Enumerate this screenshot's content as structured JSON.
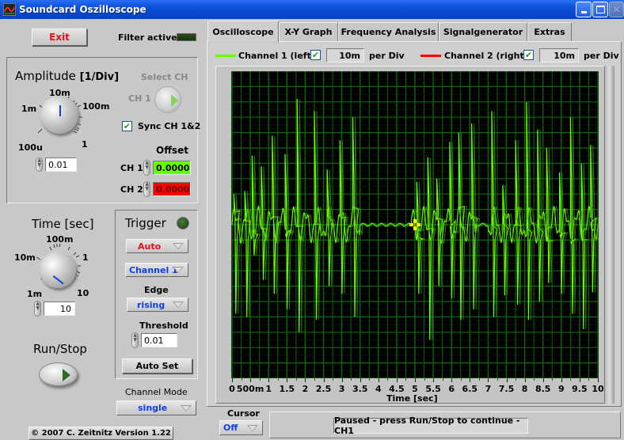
{
  "window": {
    "title": "Soundcard Oszilloscope",
    "controls": [
      "minimize",
      "maximize",
      "close"
    ]
  },
  "left_panel": {
    "exit_label": "Exit",
    "filter_label": "Filter active",
    "amplitude": {
      "title": "Amplitude",
      "unit": "[1/Div]",
      "knob_ticks": [
        "100u",
        "1m",
        "10m",
        "100m",
        "1"
      ],
      "value": "0.01"
    },
    "select_ch": {
      "label": "Select CH",
      "channel": "CH 1"
    },
    "sync": {
      "label": "Sync CH 1&2",
      "checked": true
    },
    "offset": {
      "title": "Offset",
      "ch1_label": "CH 1",
      "ch1_value": "0.0000",
      "ch2_label": "CH 2",
      "ch2_value": "0.0000"
    },
    "time": {
      "title": "Time [sec]",
      "knob_ticks": [
        "1m",
        "10m",
        "100m",
        "1",
        "10"
      ],
      "value": "10"
    },
    "trigger": {
      "title": "Trigger",
      "mode": "Auto",
      "source": "Channel 1",
      "edge_label": "Edge",
      "edge": "rising",
      "threshold_label": "Threshold",
      "threshold": "0.01",
      "autoset_label": "Auto Set"
    },
    "runstop_label": "Run/Stop",
    "channel_mode_label": "Channel Mode",
    "channel_mode": "single",
    "copyright": "© 2007   C. Zeitnitz Version 1.22"
  },
  "tabs": [
    {
      "label": "Oscilloscope",
      "active": true
    },
    {
      "label": "X-Y Graph",
      "active": false
    },
    {
      "label": "Frequency Analysis",
      "active": false
    },
    {
      "label": "Signalgenerator",
      "active": false
    },
    {
      "label": "Extras",
      "active": false
    }
  ],
  "channels": {
    "ch1": {
      "label": "Channel 1 (left)",
      "enabled": true,
      "per_div": "10m",
      "per_div_unit": "per Div",
      "color": "#66ff00"
    },
    "ch2": {
      "label": "Channel 2 (right)",
      "enabled": true,
      "per_div": "10m",
      "per_div_unit": "per Div",
      "color": "#ff0000"
    }
  },
  "cursor": {
    "label": "Cursor",
    "value": "Off"
  },
  "status": "Paused - press Run/Stop to continue - CH1",
  "chart_data": {
    "type": "line",
    "title": "",
    "xlabel": "Time [sec]",
    "ylabel": "",
    "xlim": [
      0,
      10
    ],
    "ylim": [
      -0.1,
      0.1
    ],
    "x_tick_labels": [
      "0",
      "500m",
      "1",
      "1.5",
      "2",
      "2.5",
      "3",
      "3.5",
      "4",
      "4.5",
      "5",
      "5.5",
      "6",
      "6.5",
      "7",
      "7.5",
      "8",
      "8.5",
      "9",
      "9.5",
      "10"
    ],
    "x_ticks": [
      0,
      0.5,
      1,
      1.5,
      2,
      2.5,
      3,
      3.5,
      4,
      4.5,
      5,
      5.5,
      6,
      6.5,
      7,
      7.5,
      8,
      8.5,
      9,
      9.5,
      10
    ],
    "grid": true,
    "background": "#000000",
    "grid_color": "#0a6a0a",
    "series": [
      {
        "name": "Channel 1 (left)",
        "color": "#66ff00",
        "spikes": [
          {
            "t": 0.05,
            "up": 0.02,
            "down": -0.058
          },
          {
            "t": 0.35,
            "up": 0.022,
            "down": -0.06
          },
          {
            "t": 0.55,
            "up": 0.045,
            "down": -0.02
          },
          {
            "t": 0.8,
            "up": 0.038,
            "down": -0.036
          },
          {
            "t": 1.1,
            "up": 0.058,
            "down": -0.045
          },
          {
            "t": 1.45,
            "up": 0.046,
            "down": -0.055
          },
          {
            "t": 1.78,
            "up": 0.082,
            "down": -0.07
          },
          {
            "t": 2.25,
            "up": 0.074,
            "down": -0.062
          },
          {
            "t": 2.6,
            "up": 0.036,
            "down": -0.04
          },
          {
            "t": 2.95,
            "up": 0.055,
            "down": -0.045
          },
          {
            "t": 3.3,
            "up": 0.07,
            "down": -0.06
          },
          {
            "t": 5.05,
            "up": 0.028,
            "down": -0.045
          },
          {
            "t": 5.35,
            "up": 0.044,
            "down": -0.075
          },
          {
            "t": 5.6,
            "up": 0.03,
            "down": -0.04
          },
          {
            "t": 5.95,
            "up": 0.054,
            "down": -0.048
          },
          {
            "t": 6.2,
            "up": 0.06,
            "down": -0.062
          },
          {
            "t": 6.55,
            "up": 0.066,
            "down": -0.055
          },
          {
            "t": 7.1,
            "up": 0.074,
            "down": -0.06
          },
          {
            "t": 7.4,
            "up": 0.026,
            "down": -0.046
          },
          {
            "t": 7.75,
            "up": 0.055,
            "down": -0.052
          },
          {
            "t": 8.05,
            "up": 0.08,
            "down": -0.062
          },
          {
            "t": 8.35,
            "up": 0.062,
            "down": -0.05
          },
          {
            "t": 8.6,
            "up": 0.05,
            "down": -0.038
          },
          {
            "t": 8.95,
            "up": 0.034,
            "down": -0.045
          },
          {
            "t": 9.25,
            "up": 0.07,
            "down": -0.058
          },
          {
            "t": 9.55,
            "up": 0.04,
            "down": -0.068
          },
          {
            "t": 9.8,
            "up": 0.052,
            "down": -0.044
          }
        ],
        "quiet_intervals": [
          [
            3.5,
            4.9
          ],
          [
            6.65,
            7.0
          ]
        ]
      }
    ],
    "cursor_marker": {
      "t": 5.0,
      "y": 0.0,
      "color": "#ffee00"
    }
  }
}
